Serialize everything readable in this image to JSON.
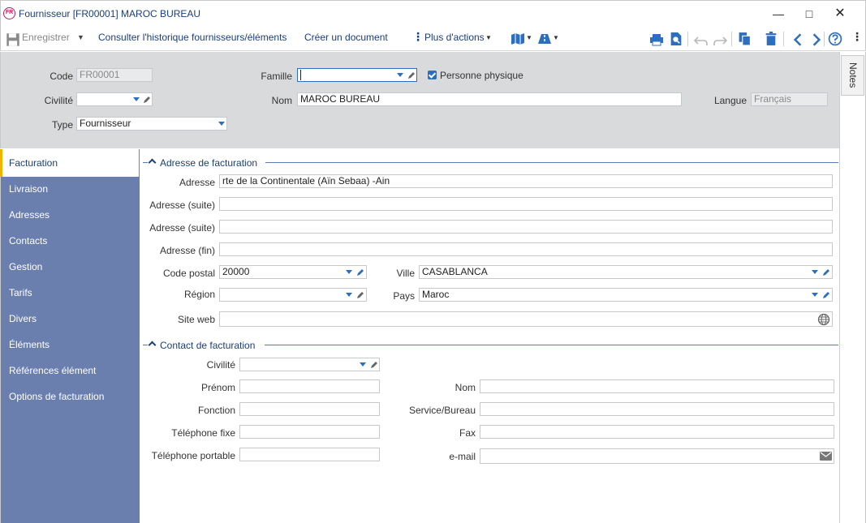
{
  "window": {
    "badge": "FR",
    "title": "Fournisseur [FR00001] MAROC BUREAU"
  },
  "toolbar": {
    "save_label": "Enregistrer",
    "history_label": "Consulter l'historique fournisseurs/éléments",
    "create_doc_label": "Créer un document",
    "more_actions_label": "Plus d'actions"
  },
  "header": {
    "code_label": "Code",
    "code_value": "FR00001",
    "famille_label": "Famille",
    "famille_value": "",
    "personne_physique_label": "Personne physique",
    "personne_physique_checked": true,
    "civilite_label": "Civilité",
    "civilite_value": "",
    "nom_label": "Nom",
    "nom_value": "MAROC BUREAU",
    "langue_label": "Langue",
    "langue_value": "Français",
    "type_label": "Type",
    "type_value": "Fournisseur"
  },
  "notes_tab": "Notes",
  "sidebar": {
    "items": [
      {
        "label": "Facturation"
      },
      {
        "label": "Livraison"
      },
      {
        "label": "Adresses"
      },
      {
        "label": "Contacts"
      },
      {
        "label": "Gestion"
      },
      {
        "label": "Tarifs"
      },
      {
        "label": "Divers"
      },
      {
        "label": "Éléments"
      },
      {
        "label": "Références élément"
      },
      {
        "label": "Options de facturation"
      }
    ],
    "active_index": 0
  },
  "billing_address": {
    "section_title": "Adresse de facturation",
    "adresse_label": "Adresse",
    "adresse_value": "rte de la Continentale (Aïn Sebaa) -Ain",
    "adresse_suite1_label": "Adresse (suite)",
    "adresse_suite1_value": "",
    "adresse_suite2_label": "Adresse (suite)",
    "adresse_suite2_value": "",
    "adresse_fin_label": "Adresse (fin)",
    "adresse_fin_value": "",
    "code_postal_label": "Code postal",
    "code_postal_value": "20000",
    "ville_label": "Ville",
    "ville_value": "CASABLANCA",
    "region_label": "Région",
    "region_value": "",
    "pays_label": "Pays",
    "pays_value": "Maroc",
    "site_web_label": "Site web",
    "site_web_value": ""
  },
  "billing_contact": {
    "section_title": "Contact de facturation",
    "civilite_label": "Civilité",
    "prenom_label": "Prénom",
    "nom_label": "Nom",
    "fonction_label": "Fonction",
    "service_label": "Service/Bureau",
    "tel_fixe_label": "Téléphone fixe",
    "fax_label": "Fax",
    "tel_portable_label": "Téléphone portable",
    "email_label": "e-mail"
  },
  "colors": {
    "accent": "#2c6fbf",
    "sidebar_bg": "#6a7fae",
    "header_bg": "#d9dadc",
    "active_marker": "#f0b400",
    "title_text": "#1a3e7a"
  }
}
